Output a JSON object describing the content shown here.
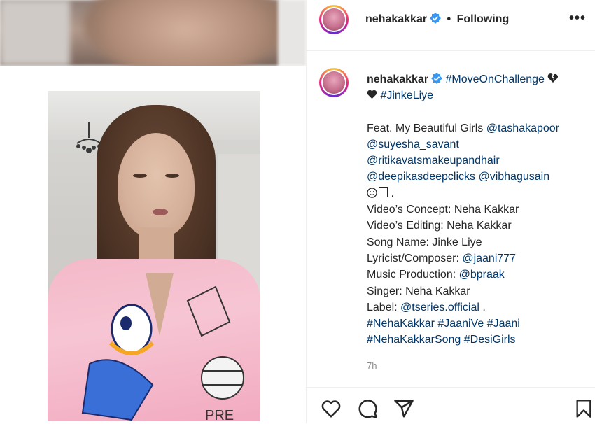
{
  "post": {
    "username": "nehakakkar",
    "separator": "•",
    "follow_status": "Following",
    "more": "•••"
  },
  "caption": {
    "username": "nehakakkar",
    "line1_tag": "#MoveOnChallenge",
    "line2_tag": "#JinkeLiye",
    "feat_prefix": "Feat. My Beautiful Girls ",
    "mention_tasha": "@tashakapoor",
    "mention_suyesha": "@suyesha_savant",
    "mention_ritika": "@ritikavatsmakeupandhair",
    "mention_deepika": "@deepikasdeepclicks",
    "mention_vibha": "@vibhagusain",
    "emoji_dot": " .",
    "concept": "Video’s Concept: Neha Kakkar",
    "editing": "Video’s Editing: Neha Kakkar",
    "song": "Song Name: Jinke Liye",
    "lyricist_prefix": "Lyricist/Composer: ",
    "mention_jaani": "@jaani777",
    "music_prefix": "Music Production: ",
    "mention_bpraak": "@bpraak",
    "singer": "Singer: Neha Kakkar",
    "label_prefix": "Label: ",
    "mention_tseries": "@tseries.official",
    "label_suffix": " .",
    "tag_nehakakkar": "#NehaKakkar",
    "tag_jaanive": "#JaaniVe",
    "tag_jaani": "#Jaani",
    "tag_nehakakkarsong": "#NehaKakkarSong",
    "tag_desigirls": "#DesiGirls",
    "time": "7h"
  },
  "icons": {
    "verified": "verified-badge-icon",
    "broken_heart": "broken-heart-icon",
    "heart": "heart-icon",
    "comment": "comment-icon",
    "share": "share-icon",
    "save": "save-icon"
  },
  "colors": {
    "link": "#00376b",
    "verified": "#3897f0",
    "muted": "#8e8e8e"
  }
}
